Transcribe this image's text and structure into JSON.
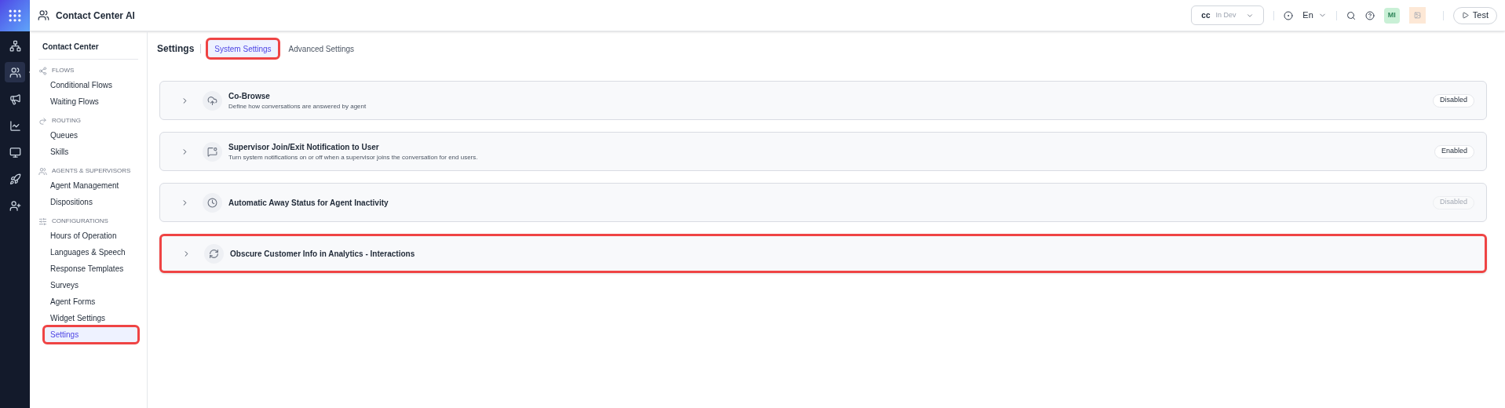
{
  "app": {
    "title": "Contact Center AI"
  },
  "rail": [
    {
      "kind": "sitemap",
      "selected": false
    },
    {
      "kind": "users",
      "selected": true
    },
    {
      "kind": "megaphone",
      "selected": false
    },
    {
      "kind": "chart",
      "selected": false
    },
    {
      "kind": "monitor",
      "selected": false
    },
    {
      "kind": "rocket",
      "selected": false
    },
    {
      "kind": "user-plus",
      "selected": false
    }
  ],
  "top_bar": {
    "environment": {
      "name": "cc",
      "stage": "In Dev"
    },
    "language": "En",
    "avatar": "MI",
    "test_button": "Test"
  },
  "sidebar": {
    "title": "Contact Center",
    "sections": [
      {
        "kind": "flows",
        "label": "FLOWS",
        "items": [
          {
            "label": "Conditional Flows",
            "selected": false
          },
          {
            "label": "Waiting Flows",
            "selected": false
          }
        ]
      },
      {
        "kind": "routing",
        "label": "ROUTING",
        "items": [
          {
            "label": "Queues",
            "selected": false
          },
          {
            "label": "Skills",
            "selected": false
          }
        ]
      },
      {
        "kind": "agents",
        "label": "AGENTS & SUPERVISORS",
        "items": [
          {
            "label": "Agent Management",
            "selected": false
          },
          {
            "label": "Dispositions",
            "selected": false
          }
        ]
      },
      {
        "kind": "configurations",
        "label": "CONFIGURATIONS",
        "items": [
          {
            "label": "Hours of Operation",
            "selected": false
          },
          {
            "label": "Languages & Speech",
            "selected": false
          },
          {
            "label": "Response Templates",
            "selected": false
          },
          {
            "label": "Surveys",
            "selected": false
          },
          {
            "label": "Agent Forms",
            "selected": false
          },
          {
            "label": "Widget Settings",
            "selected": false
          },
          {
            "label": "Settings",
            "selected": true,
            "highlighted": true
          }
        ]
      }
    ]
  },
  "page": {
    "title": "Settings",
    "tabs": [
      {
        "label": "System Settings",
        "selected": true,
        "highlighted": true
      },
      {
        "label": "Advanced Settings",
        "selected": false,
        "highlighted": false
      }
    ]
  },
  "settings": [
    {
      "kind": "cobrowse",
      "title": "Co-Browse",
      "description": "Define how conversations are answered by agent",
      "status": "Disabled",
      "disabled": false,
      "highlighted": false
    },
    {
      "kind": "notification",
      "title": "Supervisor Join/Exit Notification to User",
      "description": "Turn system notifications on or off when a supervisor joins the conversation for end users.",
      "status": "Enabled",
      "disabled": false,
      "highlighted": false
    },
    {
      "kind": "clock",
      "title": "Automatic Away Status for Agent Inactivity",
      "status": "Disabled",
      "disabled": true,
      "highlighted": false
    },
    {
      "kind": "refresh",
      "title": "Obscure Customer Info in Analytics - Interactions",
      "highlighted": true
    }
  ]
}
